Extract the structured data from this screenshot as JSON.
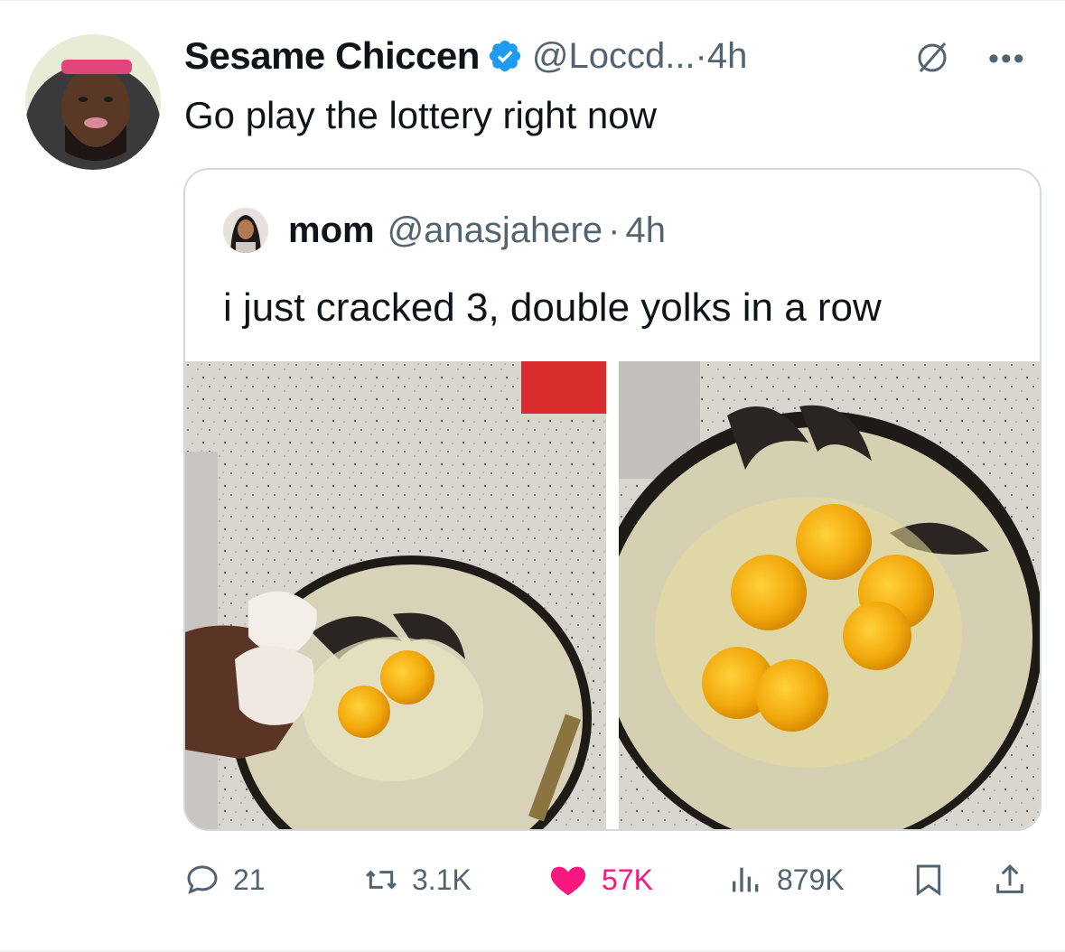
{
  "tweet": {
    "author_name": "Sesame Chiccen",
    "handle": "@Loccd...",
    "time": "4h",
    "text": "Go play the lottery right now"
  },
  "quoted": {
    "author_name": "mom",
    "handle": "@anasjahere",
    "time": "4h",
    "text": "i just cracked 3, double yolks in a row"
  },
  "actions": {
    "replies": "21",
    "reposts": "3.1K",
    "likes": "57K",
    "views": "879K"
  },
  "icons": {
    "verified": "verified-badge-icon",
    "grok": "grok-icon",
    "more": "more-icon",
    "reply": "reply-icon",
    "repost": "repost-icon",
    "like": "heart-icon",
    "views": "views-icon",
    "bookmark": "bookmark-icon",
    "share": "share-icon"
  },
  "colors": {
    "accent_blue": "#1d9bf0",
    "like_pink": "#f91880",
    "secondary_text": "#536471"
  }
}
